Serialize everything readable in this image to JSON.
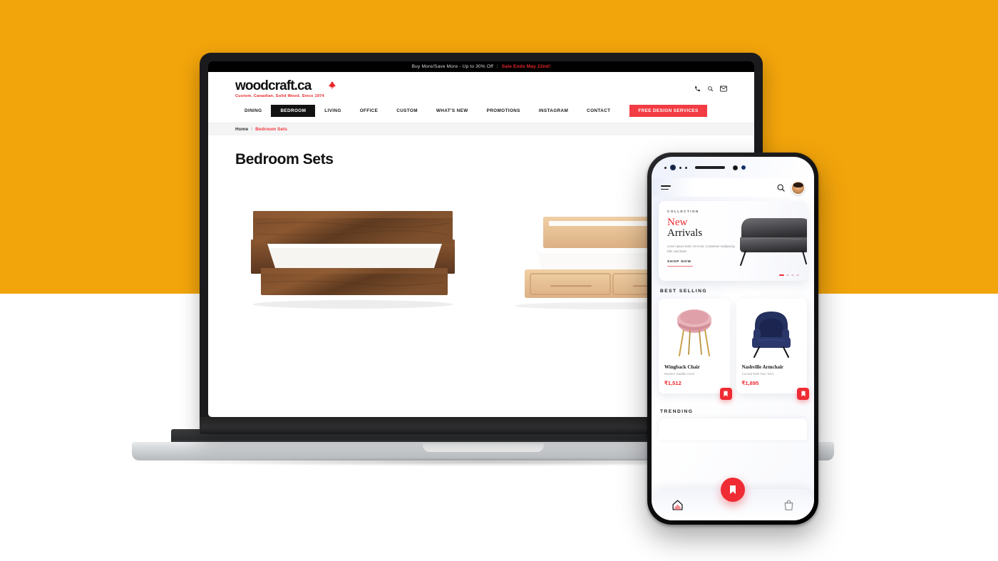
{
  "theme": {
    "background_orange": "#F2A40B",
    "page_background": "#FFFFFF",
    "accent_red": "#EF2B33",
    "brand_red": "#E8252A",
    "nav_cta_red": "#F23B42"
  },
  "desktop": {
    "promo_bar": {
      "message": "Buy More/Save More - Up to 30% Off",
      "separator": "|",
      "deadline": "Sale Ends May 22nd!"
    },
    "brand": {
      "name": "woodcraft.ca",
      "tagline": "Custom. Canadian. Solid Wood. Since 1974",
      "logo_icon": "maple-leaf-icon"
    },
    "header_icons": [
      "phone-icon",
      "search-icon",
      "envelope-icon"
    ],
    "nav": [
      {
        "label": "DINING",
        "active": false
      },
      {
        "label": "BEDROOM",
        "active": true
      },
      {
        "label": "LIVING",
        "active": false
      },
      {
        "label": "OFFICE",
        "active": false
      },
      {
        "label": "CUSTOM",
        "active": false
      },
      {
        "label": "WHAT'S NEW",
        "active": false
      },
      {
        "label": "PROMOTIONS",
        "active": false
      },
      {
        "label": "INSTAGRAM",
        "active": false
      },
      {
        "label": "CONTACT",
        "active": false
      }
    ],
    "nav_cta": "FREE DESIGN SERVICES",
    "breadcrumb": {
      "home": "Home",
      "separator": "/",
      "current": "Bedroom Sets"
    },
    "page_title": "Bedroom Sets",
    "products": [
      {
        "name": "dark-walnut-platform-bed"
      },
      {
        "name": "light-maple-storage-bed"
      }
    ]
  },
  "mobile": {
    "header": {
      "menu_icon": "hamburger-menu-icon",
      "search_icon": "search-icon",
      "avatar_icon": "user-avatar"
    },
    "hero": {
      "kicker": "COLLECTION",
      "title_accent": "New",
      "title_main": "Arrivals",
      "subtitle": "Lorem Ipsum Dolor Sit Amet, Consetetur Sadipscing Elitr, Sed Diam",
      "cta": "SHOP NOW",
      "image": "grey-sofa",
      "dots": 4,
      "active_dot": 1
    },
    "best_selling": {
      "title": "BEST SELLING",
      "items": [
        {
          "name": "Wingback Chair",
          "desc": "Modern Saddle Arms",
          "price": "₹1,512",
          "image": "pink-wingback-chair",
          "bookmark_icon": "bookmark-icon"
        },
        {
          "name": "Nashville Armchair",
          "desc": "Curved With Two Tiers",
          "price": "₹1,895",
          "image": "navy-armchair",
          "bookmark_icon": "bookmark-icon"
        }
      ]
    },
    "trending": {
      "title": "TRENDING"
    },
    "bottom_nav": {
      "items": [
        {
          "icon": "home-icon",
          "active": true
        },
        {
          "icon": "bookmark-icon",
          "active": false,
          "fab": true
        },
        {
          "icon": "shopping-bag-icon",
          "active": false
        }
      ]
    }
  }
}
